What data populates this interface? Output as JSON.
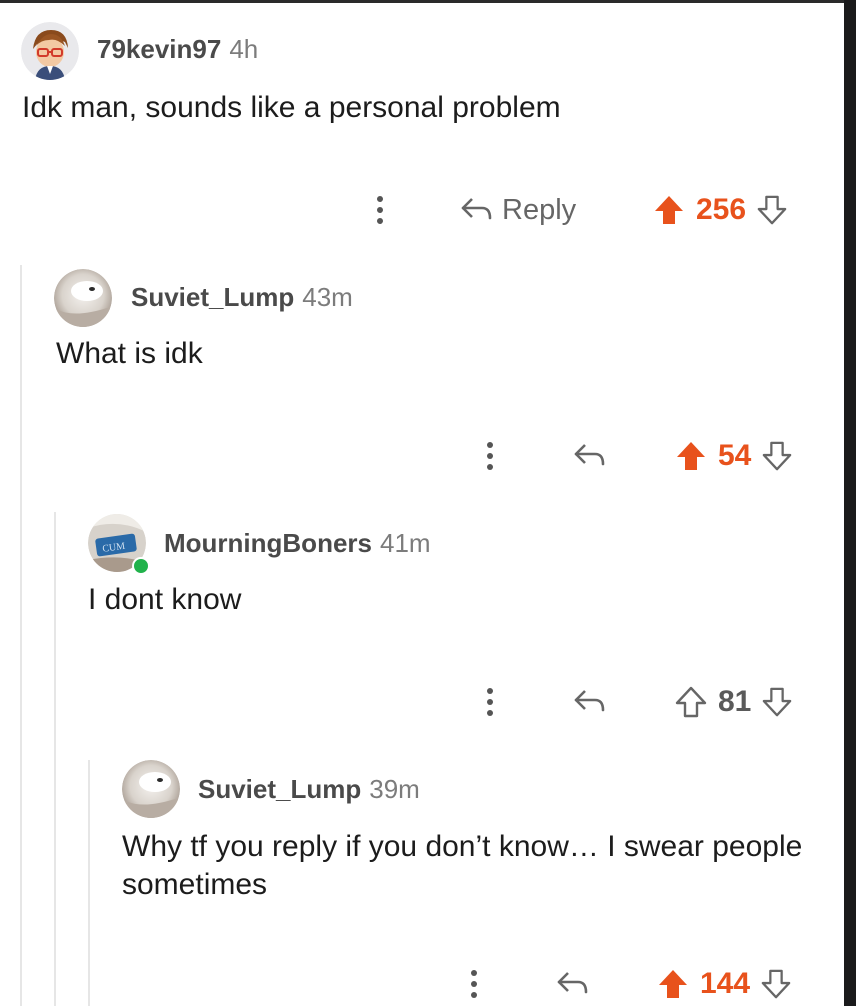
{
  "colors": {
    "accent_upvote": "#e8521c",
    "online": "#21b24b",
    "thread_line": "#e6e6e6"
  },
  "comments": [
    {
      "username": "79kevin97",
      "time": "4h",
      "body": "Idk man, sounds like a personal problem",
      "reply_label": "Reply",
      "score": "256",
      "upvoted": true,
      "avatar_icon": "cartoon-boy-avatar"
    },
    {
      "username": "Suviet_Lump",
      "time": "43m",
      "body": "What is idk",
      "reply_label": "",
      "score": "54",
      "upvoted": true,
      "avatar_icon": "possum-photo-avatar"
    },
    {
      "username": "MourningBoners",
      "time": "41m",
      "body": "I dont know",
      "reply_label": "",
      "score": "81",
      "upvoted": false,
      "online": true,
      "avatar_icon": "object-photo-avatar",
      "avatar_text": "CUM"
    },
    {
      "username": "Suviet_Lump",
      "time": "39m",
      "body": "Why tf you reply if you don’t know… I swear people sometimes",
      "reply_label": "",
      "score": "144",
      "upvoted": true,
      "avatar_icon": "possum-photo-avatar"
    }
  ]
}
